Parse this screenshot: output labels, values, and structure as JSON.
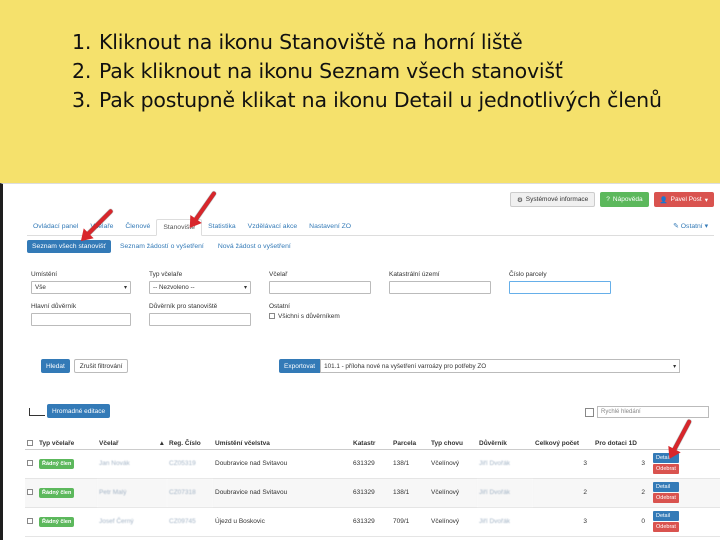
{
  "instructions": [
    {
      "num": "1.",
      "text": "Kliknout na ikonu Stanoviště na horní liště"
    },
    {
      "num": "2.",
      "text": "Pak kliknout na ikonu Seznam všech stanovišť"
    },
    {
      "num": "3.",
      "text": "Pak postupně klikat na ikonu Detail u jednotlivých členů"
    }
  ],
  "topbar": {
    "system_info": "Systémové informace",
    "help": "Nápověda",
    "user": "Pavel Post"
  },
  "nav": {
    "tabs": [
      "Ovládací panel",
      "Včelaře",
      "Členové",
      "Stanoviště",
      "Statistika",
      "Vzdělávací akce",
      "Nastavení ZO"
    ],
    "active_index": 3,
    "other": "Ostatní"
  },
  "subnav": [
    "Seznam všech stanovišť",
    "Seznam žádostí o vyšetření",
    "Nová žádost o vyšetření"
  ],
  "filters": {
    "umisteni": {
      "label": "Umístění",
      "value": "Vše"
    },
    "typ_vcelare": {
      "label": "Typ včelaře",
      "value": "-- Nezvoleno --"
    },
    "vcelar": {
      "label": "Včelař",
      "value": ""
    },
    "katastralni_uzemi": {
      "label": "Katastrální území",
      "value": ""
    },
    "cislo_parcely": {
      "label": "Číslo parcely",
      "value": ""
    },
    "hlavni_duvernik": {
      "label": "Hlavní důvěrník",
      "value": ""
    },
    "duvernik_stanoviste": {
      "label": "Důvěrník pro stanoviště",
      "value": ""
    },
    "ostatni": {
      "label": "Ostatní",
      "checkbox": "Všichni s důvěrníkem"
    }
  },
  "buttons": {
    "hledat": "Hledat",
    "zrusit": "Zrušit filtrování",
    "exportovat": "Exportovat",
    "export_option": "101.1 - příloha nové na vyšetření varroázy pro potřeby ZO",
    "hromadne": "Hromadné editace",
    "quick_placeholder": "Rychlé hledání"
  },
  "table": {
    "headers": [
      "",
      "Typ včelaře",
      "Včelař",
      "Reg. Číslo",
      "Umístění včelstva",
      "Katastr",
      "Parcela",
      "Typ chovu",
      "Důvěrník",
      "Celkový počet",
      "Pro dotaci 1D",
      ""
    ],
    "rows": [
      {
        "typ": "Řádný člen",
        "vcelar": "Jan Novák",
        "reg": "CZ05319",
        "umisteni": "Doubravice nad Svitavou",
        "katastr": "631329",
        "parcela": "138/1",
        "chov": "Včelínový",
        "duvernik": "Jiří Dvořák",
        "celkem": "3",
        "dotace": "3"
      },
      {
        "typ": "Řádný člen",
        "vcelar": "Petr Malý",
        "reg": "CZ07318",
        "umisteni": "Doubravice nad Svitavou",
        "katastr": "631329",
        "parcela": "138/1",
        "chov": "Včelínový",
        "duvernik": "Jiří Dvořák",
        "celkem": "2",
        "dotace": "2"
      },
      {
        "typ": "Řádný člen",
        "vcelar": "Josef Černý",
        "reg": "CZ09745",
        "umisteni": "Újezd u Boskovic",
        "katastr": "631329",
        "parcela": "709/1",
        "chov": "Včelínový",
        "duvernik": "Jiří Dvořák",
        "celkem": "3",
        "dotace": "0"
      }
    ],
    "detail": "Detail",
    "odebrat": "Odebrat"
  }
}
